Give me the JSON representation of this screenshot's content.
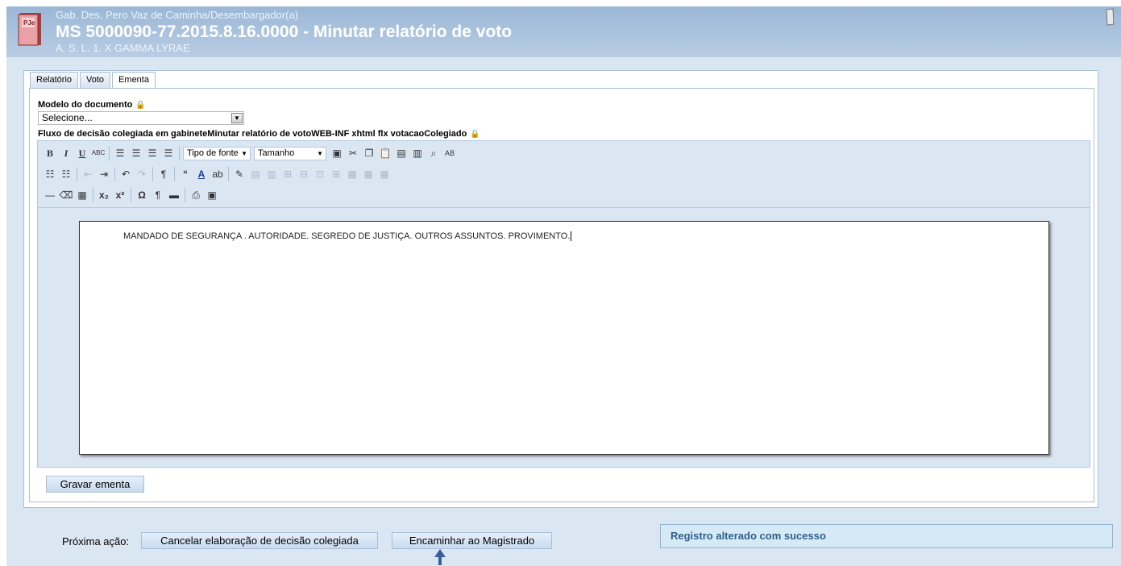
{
  "header": {
    "subtitle": "Gab. Des. Pero Vaz de Caminha/Desembargador(a)",
    "title": "MS 5000090-77.2015.8.16.0000 - Minutar relatório de voto",
    "party": "A. S. L. 1. X GAMMA LYRAE",
    "logo_text": "PJe"
  },
  "tabs": [
    {
      "label": "Relatório",
      "active": false
    },
    {
      "label": "Voto",
      "active": false
    },
    {
      "label": "Ementa",
      "active": true
    }
  ],
  "form": {
    "modelo_label": "Modelo do documento",
    "modelo_value": "Selecione...",
    "fluxo_label": "Fluxo de decisão colegiada em gabineteMinutar relatório de votoWEB-INF xhtml flx votacaoColegiado"
  },
  "toolbar": {
    "font_family_label": "Tipo de fonte",
    "font_size_label": "Tamanho"
  },
  "document": {
    "text": "MANDADO DE SEGURANÇA . AUTORIDADE. SEGREDO DE JUSTIÇA. OUTROS ASSUNTOS. PROVIMENTO."
  },
  "buttons": {
    "gravar": "Gravar ementa",
    "proxima_label": "Próxima ação:",
    "cancelar": "Cancelar elaboração de decisão colegiada",
    "encaminhar": "Encaminhar ao Magistrado"
  },
  "status": {
    "message": "Registro alterado com sucesso"
  },
  "colors": {
    "header_bg": "#9bb7d6",
    "panel_bg": "#dbe6f3",
    "message_text": "#2f5f8a"
  }
}
